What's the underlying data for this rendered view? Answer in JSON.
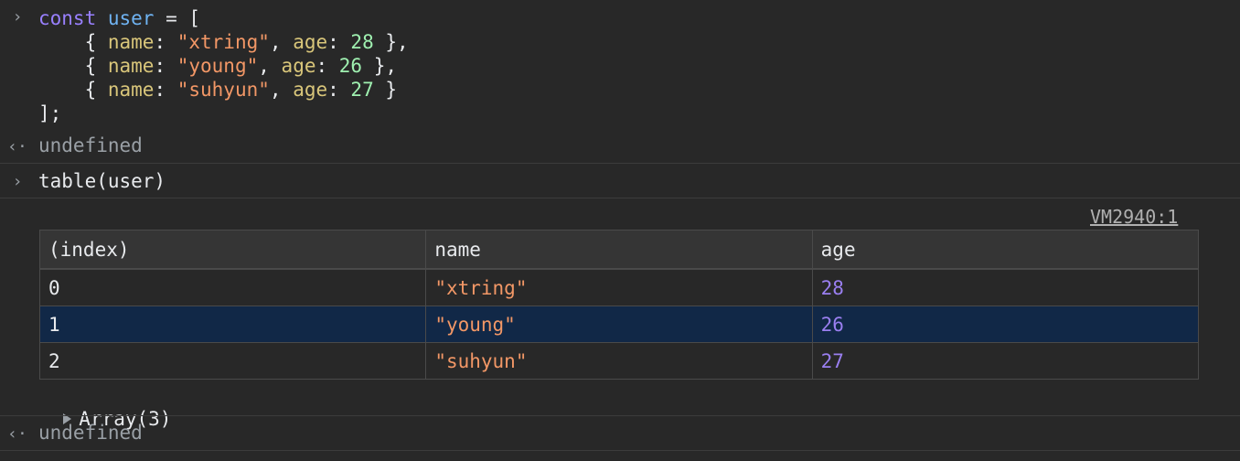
{
  "console": {
    "input1": {
      "line1": {
        "kw": "const",
        "var": "user",
        "op": " = ["
      },
      "rows": [
        {
          "prop1": "name",
          "str": "\"xtring\"",
          "prop2": "age",
          "num": "28",
          "end": " },"
        },
        {
          "prop1": "name",
          "str": "\"young\"",
          "prop2": "age",
          "num": "26",
          "end": " },"
        },
        {
          "prop1": "name",
          "str": "\"suhyun\"",
          "prop2": "age",
          "num": "27",
          "end": " }"
        }
      ],
      "close": "];"
    },
    "result1": "undefined",
    "input2": "table(user)",
    "source_link": "VM2940:1",
    "table": {
      "headers": [
        "(index)",
        "name",
        "age"
      ],
      "rows": [
        {
          "index": "0",
          "name": "\"xtring\"",
          "age": "28"
        },
        {
          "index": "1",
          "name": "\"young\"",
          "age": "26"
        },
        {
          "index": "2",
          "name": "\"suhyun\"",
          "age": "27"
        }
      ]
    },
    "array_label": "Array(3)",
    "result2": "undefined"
  },
  "icons": {
    "prompt": "›",
    "result": "‹·"
  },
  "colors": {
    "background": "#282828",
    "keyword": "#9980ff",
    "variable": "#6fb3f2",
    "property": "#d9c67a",
    "string": "#f29766",
    "number": "#9ff0b0",
    "table_number": "#9a7ff0",
    "selected_row": "#112847"
  }
}
